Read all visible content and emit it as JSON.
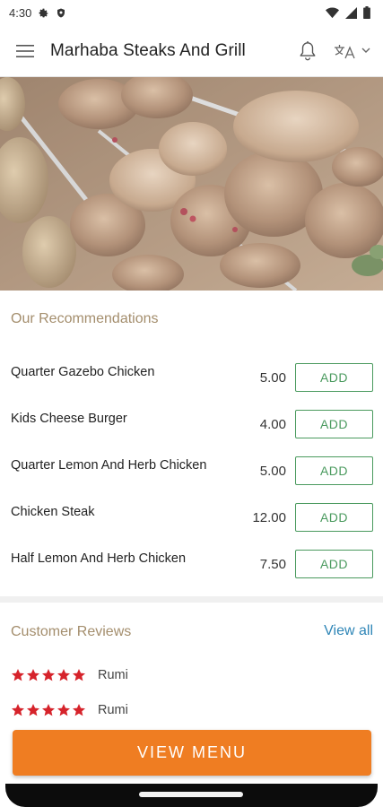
{
  "status_bar": {
    "time": "4:30"
  },
  "app_bar": {
    "title": "Marhaba Steaks And Grill"
  },
  "recommendations": {
    "title": "Our Recommendations",
    "items": [
      {
        "name": "Quarter Gazebo Chicken",
        "price": "5.00",
        "button": "ADD"
      },
      {
        "name": "Kids Cheese Burger",
        "price": "4.00",
        "button": "ADD"
      },
      {
        "name": "Quarter Lemon And Herb Chicken",
        "price": "5.00",
        "button": "ADD"
      },
      {
        "name": "Chicken Steak",
        "price": "12.00",
        "button": "ADD"
      },
      {
        "name": "Half Lemon And Herb Chicken",
        "price": "7.50",
        "button": "ADD"
      }
    ]
  },
  "reviews": {
    "title": "Customer Reviews",
    "view_all": "View all",
    "items": [
      {
        "reviewer": "Rumi",
        "rating": 5,
        "max_rating": 5
      },
      {
        "reviewer": "Rumi",
        "rating": 5,
        "max_rating": 5
      }
    ]
  },
  "cta": {
    "label": "VIEW MENU"
  },
  "colors": {
    "accent_orange": "#ef7d22",
    "add_green": "#4a9a5e",
    "section_title": "#a48e6d",
    "link_blue": "#2f86b7",
    "star_red": "#d6232b"
  },
  "icons": {
    "status": [
      "settings-icon",
      "shield-icon",
      "wifi-icon",
      "signal-icon",
      "battery-icon"
    ],
    "app_bar": [
      "hamburger-menu-icon",
      "bell-icon",
      "translate-icon",
      "chevron-down-icon"
    ],
    "review": "star-icon"
  }
}
